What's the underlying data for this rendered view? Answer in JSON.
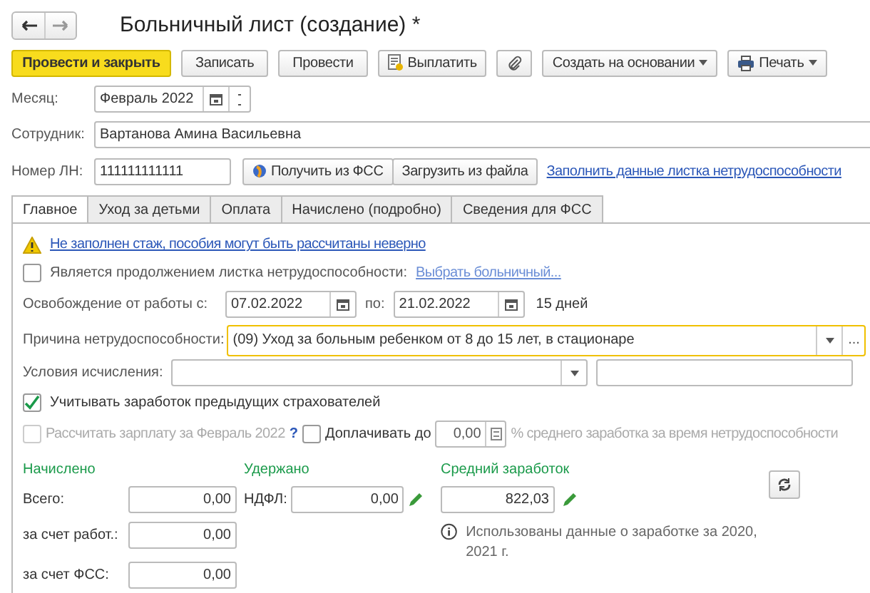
{
  "title": "Больничный лист (создание) *",
  "toolbar": [
    {
      "kind": "primary",
      "label": "Провести и закрыть"
    },
    {
      "kind": "plain",
      "label": "Записать"
    },
    {
      "kind": "plain",
      "label": "Провести"
    },
    {
      "kind": "pay",
      "label": "Выплатить"
    },
    {
      "kind": "clip"
    },
    {
      "kind": "menu",
      "label": "Создать на основании"
    },
    {
      "kind": "print",
      "label": "Печать"
    }
  ],
  "month": {
    "label": "Месяц:",
    "value": "Февраль 2022"
  },
  "employee": {
    "label": "Сотрудник:",
    "value": "Вартанова Амина Васильевна"
  },
  "number": {
    "label": "Номер ЛН:",
    "value": "111111111111",
    "get_button": "Получить из ФСС",
    "load_button": "Загрузить из файла",
    "fill_link": "Заполнить данные листка нетрудоспособности"
  },
  "tabs": [
    {
      "label": "Главное",
      "selected": true
    },
    {
      "label": "Уход за детьми",
      "selected": false
    },
    {
      "label": "Оплата",
      "selected": false
    },
    {
      "label": "Начислено (подробно)",
      "selected": false
    },
    {
      "label": "Сведения для ФСС",
      "selected": false
    }
  ],
  "warning": "Не заполнен стаж, пособия могут быть рассчитаны неверно",
  "continuation": {
    "label": "Является продолжением листка нетрудоспособности:",
    "checked": false,
    "link": "Выбрать больничный..."
  },
  "release": {
    "label": "Освобождение от работы с:",
    "from": "07.02.2022",
    "to_label": "по:",
    "to": "21.02.2022",
    "days": "15 дней"
  },
  "cause": {
    "label": "Причина нетрудоспособности:",
    "value": "(09) Уход за больным ребенком от 8 до 15 лет, в стационаре",
    "more": "..."
  },
  "conditions": {
    "label": "Условия исчисления:"
  },
  "prev_insurers": {
    "label": "Учитывать заработок предыдущих страхователей",
    "checked": true
  },
  "salary_calc": {
    "label": "Рассчитать зарплату за Февраль 2022",
    "checked": false,
    "disabled": true,
    "help": "?"
  },
  "topup": {
    "label": "Доплачивать до",
    "checked": false,
    "value": "0,00",
    "suffix": "% среднего заработка за время нетрудоспособности"
  },
  "accrued": {
    "heading": "Начислено",
    "rows": [
      {
        "label": "Всего:",
        "value": "0,00"
      },
      {
        "label": "за счет работ.:",
        "value": "0,00"
      },
      {
        "label": "за счет ФСС:",
        "value": "0,00"
      }
    ]
  },
  "withheld": {
    "heading": "Удержано",
    "label": "НДФЛ:",
    "value": "0,00"
  },
  "average": {
    "heading": "Средний заработок",
    "value": "822,03",
    "note": "Использованы данные о заработке за 2020,  2021 г."
  }
}
